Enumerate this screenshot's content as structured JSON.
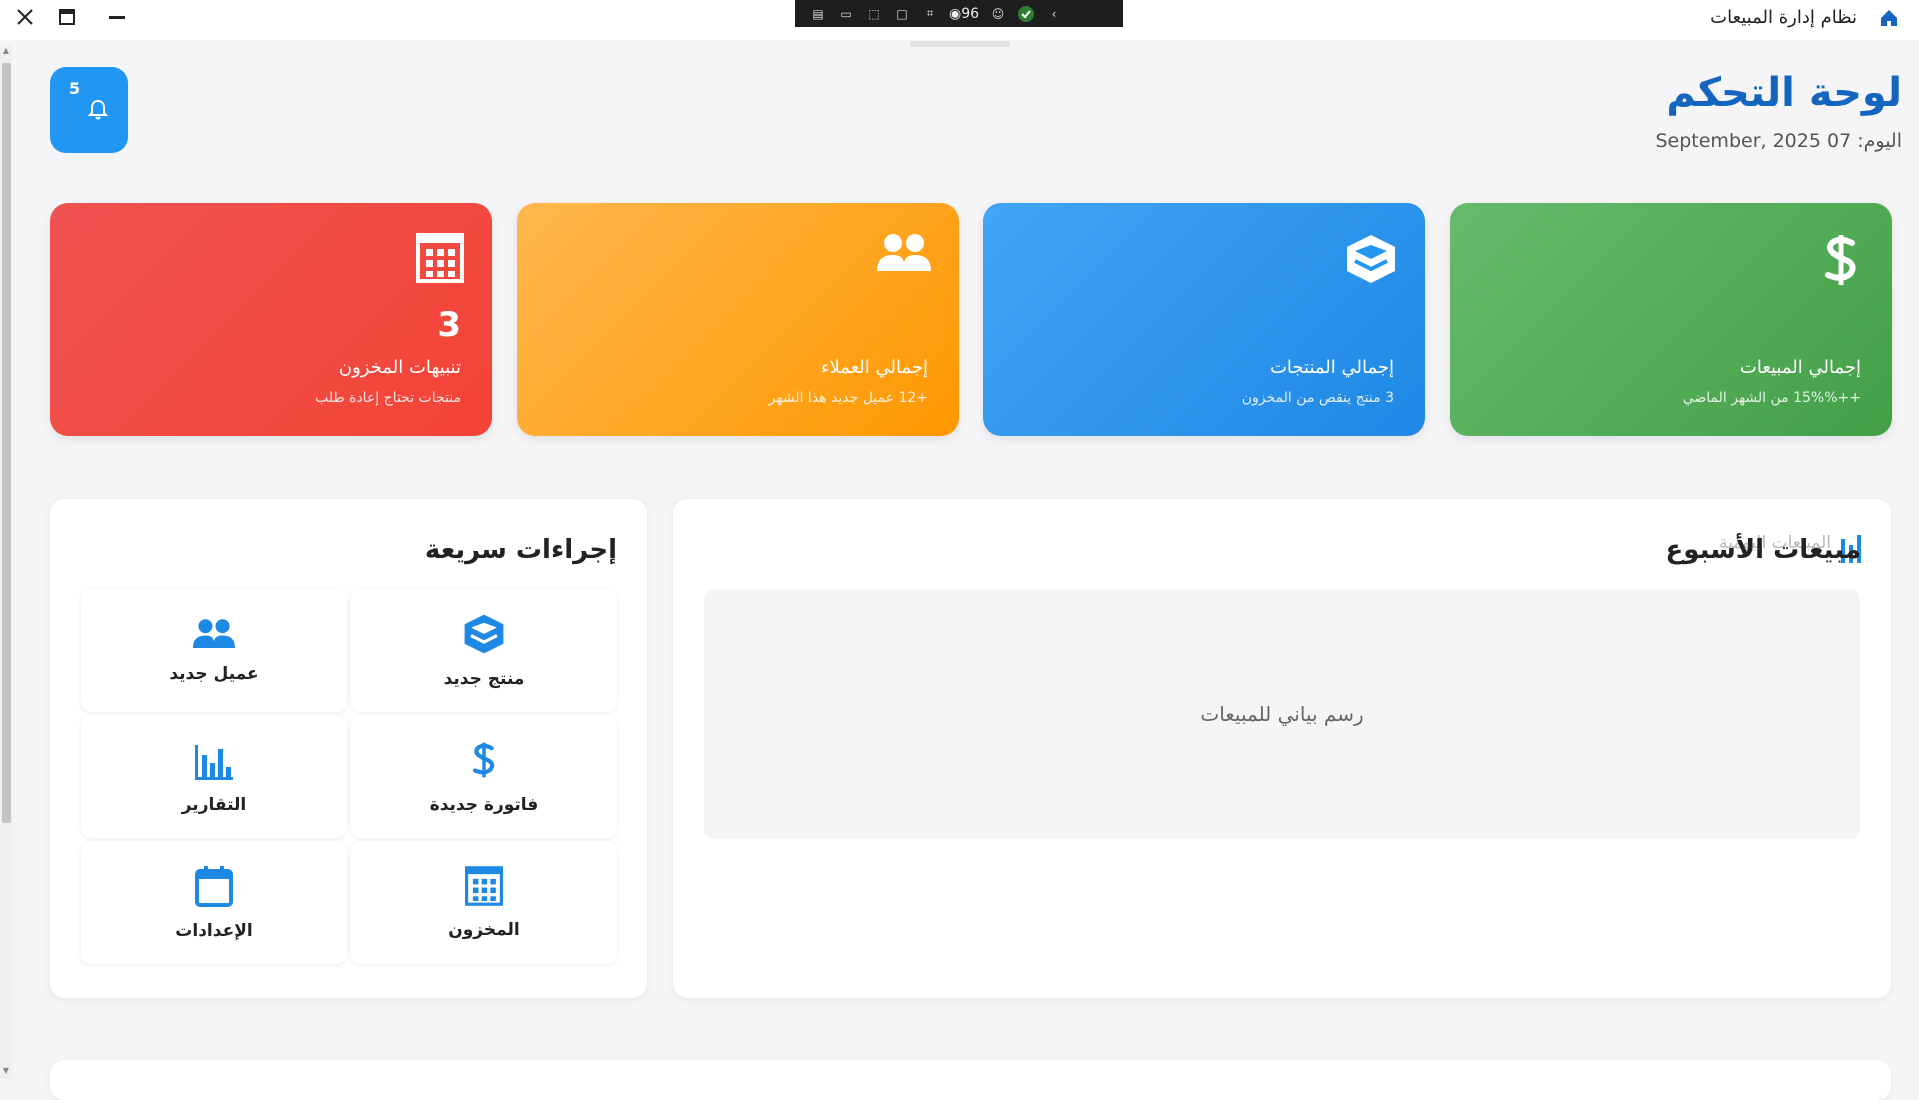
{
  "window": {
    "title": "نظام إدارة المبيعات",
    "icon": "home-icon"
  },
  "devtools": {
    "fps": "96"
  },
  "header": {
    "title": "لوحة التحكم",
    "date_line": "اليوم: 07 September, 2025",
    "notifications_count": "5"
  },
  "stats": [
    {
      "icon": "dollar-icon",
      "value": "",
      "label": "إجمالي المبيعات",
      "sub": "++15%% من الشهر الماضي",
      "color": "#4caf50"
    },
    {
      "icon": "box-icon",
      "value": "",
      "label": "إجمالي المنتجات",
      "sub": "3 منتج ينقص من المخزون",
      "color": "#2196f3"
    },
    {
      "icon": "users-icon",
      "value": "",
      "label": "إجمالي العملاء",
      "sub": "+12 عميل جديد هذا الشهر",
      "color": "#ff9800"
    },
    {
      "icon": "grid-icon",
      "value": "3",
      "label": "تنبيهات المخزون",
      "sub": "منتجات تحتاج إعادة طلب",
      "color": "#f44336"
    }
  ],
  "chart": {
    "title": "مبيعات الأسبوع",
    "legend": "المبيعات اليومية",
    "placeholder": "رسم بياني للمبيعات"
  },
  "quick_actions": {
    "title": "إجراءات سريعة",
    "items": [
      {
        "icon": "box-icon",
        "label": "منتج جديد"
      },
      {
        "icon": "users-icon",
        "label": "عميل جديد"
      },
      {
        "icon": "dollar-icon",
        "label": "فاتورة جديدة"
      },
      {
        "icon": "bar-chart-icon",
        "label": "التقارير"
      },
      {
        "icon": "grid-icon",
        "label": "المخزون"
      },
      {
        "icon": "calendar-icon",
        "label": "الإعدادات"
      }
    ]
  },
  "colors": {
    "accent": "#2196f3",
    "title_blue": "#1565c0",
    "icon_blue": "#1e88e5"
  }
}
